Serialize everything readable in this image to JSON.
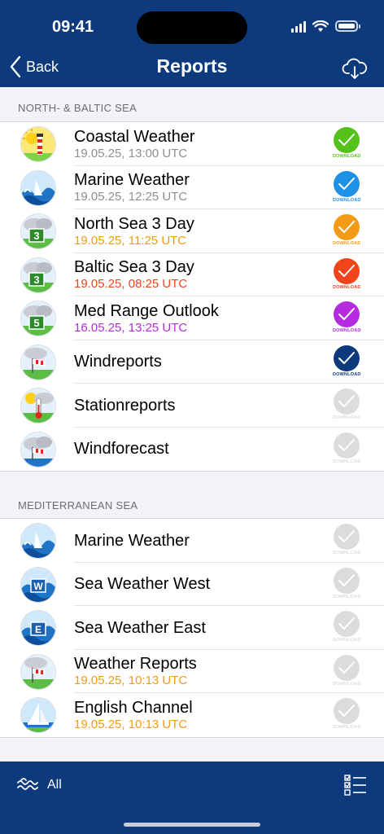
{
  "status_bar": {
    "time": "09:41"
  },
  "nav": {
    "back_label": "Back",
    "title": "Reports"
  },
  "sections": [
    {
      "header": "NORTH- & BALTIC SEA",
      "items": [
        {
          "title": "Coastal Weather",
          "subtitle": "19.05.25, 13:00 UTC",
          "subtitle_color": "#8e8e93",
          "icon": "lighthouse-icon",
          "status_color": "#55c21b",
          "active": true
        },
        {
          "title": "Marine Weather",
          "subtitle": "19.05.25, 12:25 UTC",
          "subtitle_color": "#8e8e93",
          "icon": "wave-boat-icon",
          "status_color": "#1e90e8",
          "active": true
        },
        {
          "title": "North Sea 3 Day",
          "subtitle": "19.05.25, 11:25 UTC",
          "subtitle_color": "#f39a16",
          "icon": "forecast-3-icon",
          "status_color": "#f39a16",
          "active": true
        },
        {
          "title": "Baltic Sea 3 Day",
          "subtitle": "19.05.25, 08:25 UTC",
          "subtitle_color": "#f0441a",
          "icon": "forecast-3-icon",
          "status_color": "#f0441a",
          "active": true
        },
        {
          "title": "Med Range Outlook",
          "subtitle": "16.05.25, 13:25 UTC",
          "subtitle_color": "#b52ce0",
          "icon": "forecast-5-icon",
          "status_color": "#b52ce0",
          "active": true
        },
        {
          "title": "Windreports",
          "subtitle": "",
          "subtitle_color": "",
          "icon": "windsock-icon",
          "status_color": "#0d3a7d",
          "active": true
        },
        {
          "title": "Stationreports",
          "subtitle": "",
          "subtitle_color": "",
          "icon": "thermometer-icon",
          "status_color": "#dcdcdc",
          "active": false
        },
        {
          "title": "Windforecast",
          "subtitle": "",
          "subtitle_color": "",
          "icon": "windsock-cloud-icon",
          "status_color": "#dcdcdc",
          "active": false
        }
      ]
    },
    {
      "header": "MEDITERRANEAN SEA",
      "items": [
        {
          "title": "Marine Weather",
          "subtitle": "",
          "subtitle_color": "",
          "icon": "wave-boat-icon",
          "status_color": "#dcdcdc",
          "active": false
        },
        {
          "title": "Sea Weather West",
          "subtitle": "",
          "subtitle_color": "",
          "icon": "wave-w-icon",
          "status_color": "#dcdcdc",
          "active": false
        },
        {
          "title": "Sea Weather East",
          "subtitle": "",
          "subtitle_color": "",
          "icon": "wave-e-icon",
          "status_color": "#dcdcdc",
          "active": false
        },
        {
          "title": "Weather Reports",
          "subtitle": "19.05.25, 10:13 UTC",
          "subtitle_color": "#f39a16",
          "icon": "windsock-icon",
          "status_color": "#dcdcdc",
          "active": false
        },
        {
          "title": "English Channel",
          "subtitle": "19.05.25, 10:13 UTC",
          "subtitle_color": "#f39a16",
          "icon": "sailboat-icon",
          "status_color": "#dcdcdc",
          "active": false
        }
      ]
    }
  ],
  "download_label": "DOWNLOAD",
  "bottom_bar": {
    "all_label": "All"
  }
}
